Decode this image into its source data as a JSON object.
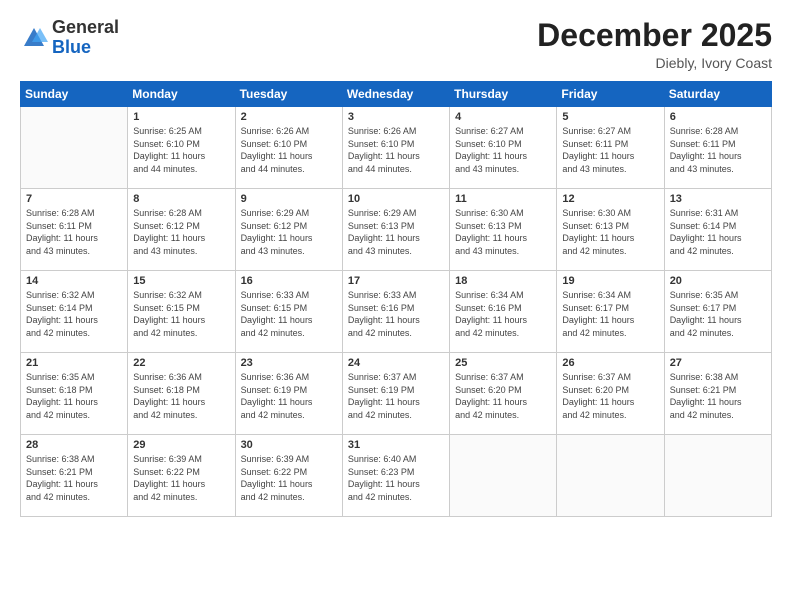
{
  "logo": {
    "general": "General",
    "blue": "Blue"
  },
  "header": {
    "month": "December 2025",
    "location": "Diebly, Ivory Coast"
  },
  "weekdays": [
    "Sunday",
    "Monday",
    "Tuesday",
    "Wednesday",
    "Thursday",
    "Friday",
    "Saturday"
  ],
  "weeks": [
    [
      {
        "day": "",
        "info": ""
      },
      {
        "day": "1",
        "info": "Sunrise: 6:25 AM\nSunset: 6:10 PM\nDaylight: 11 hours\nand 44 minutes."
      },
      {
        "day": "2",
        "info": "Sunrise: 6:26 AM\nSunset: 6:10 PM\nDaylight: 11 hours\nand 44 minutes."
      },
      {
        "day": "3",
        "info": "Sunrise: 6:26 AM\nSunset: 6:10 PM\nDaylight: 11 hours\nand 44 minutes."
      },
      {
        "day": "4",
        "info": "Sunrise: 6:27 AM\nSunset: 6:10 PM\nDaylight: 11 hours\nand 43 minutes."
      },
      {
        "day": "5",
        "info": "Sunrise: 6:27 AM\nSunset: 6:11 PM\nDaylight: 11 hours\nand 43 minutes."
      },
      {
        "day": "6",
        "info": "Sunrise: 6:28 AM\nSunset: 6:11 PM\nDaylight: 11 hours\nand 43 minutes."
      }
    ],
    [
      {
        "day": "7",
        "info": "Sunrise: 6:28 AM\nSunset: 6:11 PM\nDaylight: 11 hours\nand 43 minutes."
      },
      {
        "day": "8",
        "info": "Sunrise: 6:28 AM\nSunset: 6:12 PM\nDaylight: 11 hours\nand 43 minutes."
      },
      {
        "day": "9",
        "info": "Sunrise: 6:29 AM\nSunset: 6:12 PM\nDaylight: 11 hours\nand 43 minutes."
      },
      {
        "day": "10",
        "info": "Sunrise: 6:29 AM\nSunset: 6:13 PM\nDaylight: 11 hours\nand 43 minutes."
      },
      {
        "day": "11",
        "info": "Sunrise: 6:30 AM\nSunset: 6:13 PM\nDaylight: 11 hours\nand 43 minutes."
      },
      {
        "day": "12",
        "info": "Sunrise: 6:30 AM\nSunset: 6:13 PM\nDaylight: 11 hours\nand 42 minutes."
      },
      {
        "day": "13",
        "info": "Sunrise: 6:31 AM\nSunset: 6:14 PM\nDaylight: 11 hours\nand 42 minutes."
      }
    ],
    [
      {
        "day": "14",
        "info": "Sunrise: 6:32 AM\nSunset: 6:14 PM\nDaylight: 11 hours\nand 42 minutes."
      },
      {
        "day": "15",
        "info": "Sunrise: 6:32 AM\nSunset: 6:15 PM\nDaylight: 11 hours\nand 42 minutes."
      },
      {
        "day": "16",
        "info": "Sunrise: 6:33 AM\nSunset: 6:15 PM\nDaylight: 11 hours\nand 42 minutes."
      },
      {
        "day": "17",
        "info": "Sunrise: 6:33 AM\nSunset: 6:16 PM\nDaylight: 11 hours\nand 42 minutes."
      },
      {
        "day": "18",
        "info": "Sunrise: 6:34 AM\nSunset: 6:16 PM\nDaylight: 11 hours\nand 42 minutes."
      },
      {
        "day": "19",
        "info": "Sunrise: 6:34 AM\nSunset: 6:17 PM\nDaylight: 11 hours\nand 42 minutes."
      },
      {
        "day": "20",
        "info": "Sunrise: 6:35 AM\nSunset: 6:17 PM\nDaylight: 11 hours\nand 42 minutes."
      }
    ],
    [
      {
        "day": "21",
        "info": "Sunrise: 6:35 AM\nSunset: 6:18 PM\nDaylight: 11 hours\nand 42 minutes."
      },
      {
        "day": "22",
        "info": "Sunrise: 6:36 AM\nSunset: 6:18 PM\nDaylight: 11 hours\nand 42 minutes."
      },
      {
        "day": "23",
        "info": "Sunrise: 6:36 AM\nSunset: 6:19 PM\nDaylight: 11 hours\nand 42 minutes."
      },
      {
        "day": "24",
        "info": "Sunrise: 6:37 AM\nSunset: 6:19 PM\nDaylight: 11 hours\nand 42 minutes."
      },
      {
        "day": "25",
        "info": "Sunrise: 6:37 AM\nSunset: 6:20 PM\nDaylight: 11 hours\nand 42 minutes."
      },
      {
        "day": "26",
        "info": "Sunrise: 6:37 AM\nSunset: 6:20 PM\nDaylight: 11 hours\nand 42 minutes."
      },
      {
        "day": "27",
        "info": "Sunrise: 6:38 AM\nSunset: 6:21 PM\nDaylight: 11 hours\nand 42 minutes."
      }
    ],
    [
      {
        "day": "28",
        "info": "Sunrise: 6:38 AM\nSunset: 6:21 PM\nDaylight: 11 hours\nand 42 minutes."
      },
      {
        "day": "29",
        "info": "Sunrise: 6:39 AM\nSunset: 6:22 PM\nDaylight: 11 hours\nand 42 minutes."
      },
      {
        "day": "30",
        "info": "Sunrise: 6:39 AM\nSunset: 6:22 PM\nDaylight: 11 hours\nand 42 minutes."
      },
      {
        "day": "31",
        "info": "Sunrise: 6:40 AM\nSunset: 6:23 PM\nDaylight: 11 hours\nand 42 minutes."
      },
      {
        "day": "",
        "info": ""
      },
      {
        "day": "",
        "info": ""
      },
      {
        "day": "",
        "info": ""
      }
    ]
  ]
}
